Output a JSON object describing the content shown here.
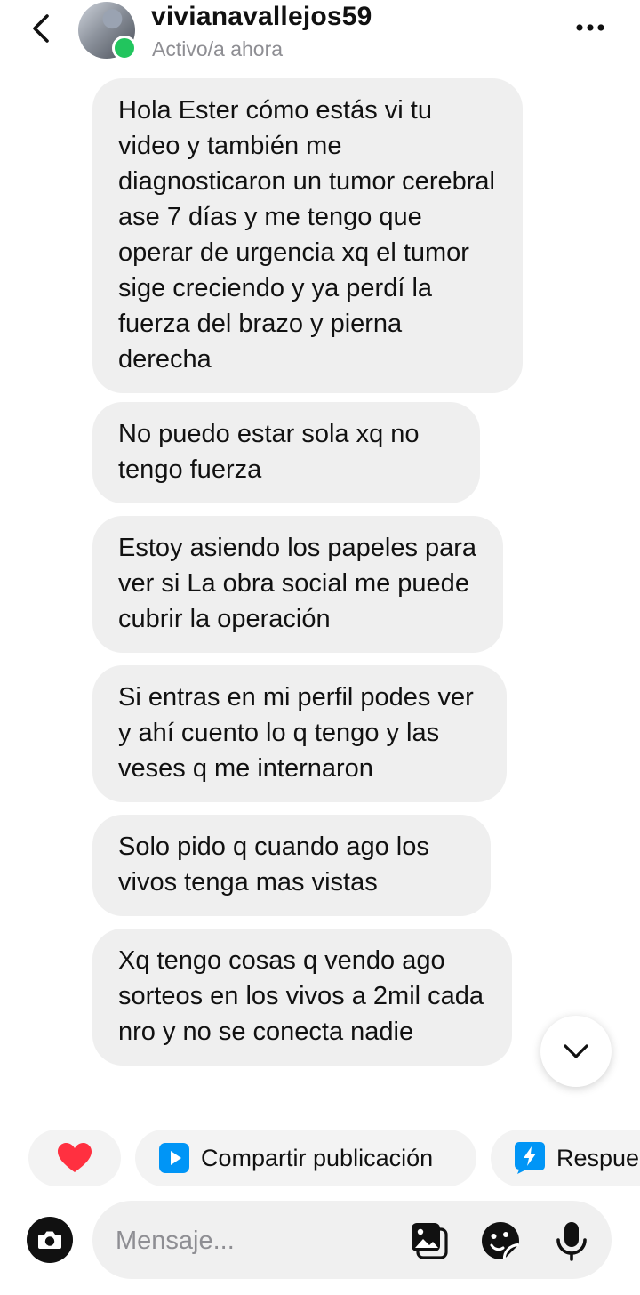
{
  "header": {
    "username": "vivianavallejos59",
    "status": "Activo/a ahora",
    "icons": {
      "back": "chevron-left-icon",
      "more": "more-horizontal-icon",
      "online": "online-indicator"
    },
    "accent": "#22c55e"
  },
  "messages": [
    {
      "text": "Hola Ester cómo estás vi tu video y también me diagnosticaron un tumor cerebral ase 7 días y me tengo que operar de urgencia xq el tumor sige creciendo y ya perdí la fuerza del brazo y pierna derecha"
    },
    {
      "text": "No puedo estar sola xq no tengo fuerza"
    },
    {
      "text": "Estoy asiendo los papeles para ver si La obra social me puede cubrir la operación"
    },
    {
      "text": "Si entras en mi perfil podes ver y ahí cuento lo q tengo y las veses q me internaron"
    },
    {
      "text": "Solo pido q cuando ago los vivos tenga mas vistas"
    },
    {
      "text": "Xq tengo cosas q vendo ago sorteos en los vivos a 2mil cada nro y no se conecta nadie"
    }
  ],
  "quick_actions": {
    "share_label": "Compartir publicación",
    "reply_label": "Respue",
    "heart_color": "#ff3040",
    "share_color": "#0095f6",
    "reply_color": "#0095f6"
  },
  "composer": {
    "placeholder": "Mensaje...",
    "icons": [
      "camera-icon",
      "gallery-icon",
      "sticker-icon",
      "microphone-icon"
    ]
  }
}
